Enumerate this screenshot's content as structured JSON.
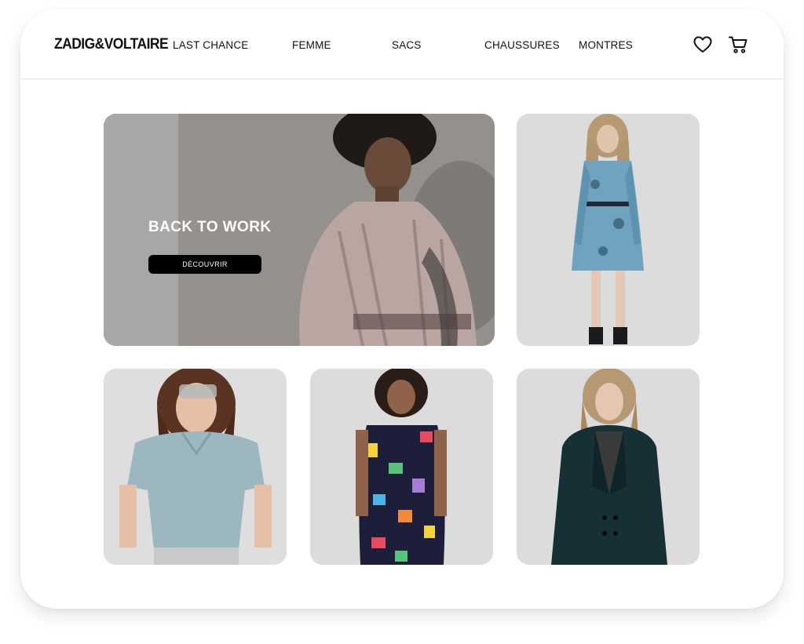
{
  "brand": {
    "logo_text": "ZADIG&VOLTAIRE"
  },
  "nav": {
    "items": [
      {
        "label": "LAST CHANCE"
      },
      {
        "label": "FEMME"
      },
      {
        "label": "SACS"
      },
      {
        "label": "CHAUSSURES"
      },
      {
        "label": "MONTRES"
      }
    ]
  },
  "header_icons": [
    "heart-icon",
    "cart-icon"
  ],
  "hero": {
    "title": "BACK TO WORK",
    "cta_label": "DÉCOUVRIR"
  },
  "products": [
    {
      "image": "blue-floral-shirt-dress"
    },
    {
      "image": "light-blue-v-neck-tshirt"
    },
    {
      "image": "multicolor-horse-print-dress"
    },
    {
      "image": "dark-velvet-blazer"
    }
  ],
  "colors": {
    "text": "#111111",
    "cta_background": "#000000",
    "cta_text": "#ffffff",
    "tile_background": "#d9d9d9"
  }
}
